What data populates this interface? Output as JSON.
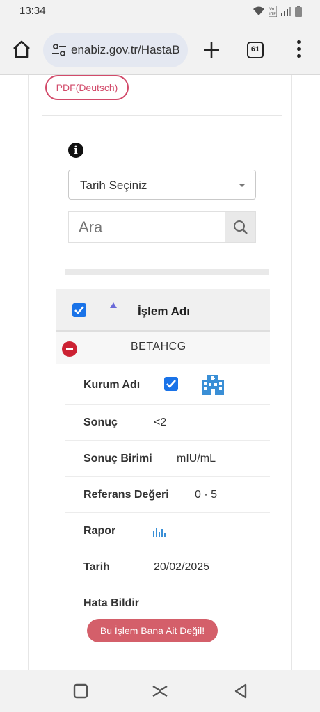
{
  "status_bar": {
    "time": "13:34",
    "icons": [
      "wifi-icon",
      "volte-icon",
      "signal-icon",
      "battery-icon"
    ]
  },
  "browser": {
    "url": "enabiz.gov.tr/HastaB",
    "tab_count": "61",
    "icons": [
      "home-icon",
      "site-settings-icon",
      "new-tab-icon",
      "tabs-icon",
      "more-menu-icon"
    ]
  },
  "page": {
    "pdf_button": "PDF(Deutsch)",
    "date_select": {
      "selected": "Tarih Seçiniz"
    },
    "search": {
      "placeholder": "Ara"
    },
    "table": {
      "header": {
        "column": "İşlem Adı",
        "checked": true
      },
      "group": {
        "name": "BETAHCG"
      },
      "rows": [
        {
          "label": "Kurum Adı",
          "value": "",
          "icons": [
            "checkbox-checked-icon",
            "hospital-icon"
          ]
        },
        {
          "label": "Sonuç",
          "value": "<2"
        },
        {
          "label": "Sonuç Birimi",
          "value": "mIU/mL"
        },
        {
          "label": "Referans Değeri",
          "value": "0 - 5"
        },
        {
          "label": "Rapor",
          "value": "",
          "icons": [
            "chart-icon"
          ]
        },
        {
          "label": "Tarih",
          "value": "20/02/2025"
        },
        {
          "label": "Hata Bildir",
          "value": ""
        }
      ],
      "report_button": "Bu İşlem Bana Ait Değil!"
    }
  },
  "colors": {
    "accent_pink": "#d24a6a",
    "checkbox_blue": "#1a73e8",
    "danger_red": "#cc2233",
    "report_button_bg": "#d45f6a",
    "icon_blue": "#3a8fd6"
  },
  "nav_bar": {
    "icons": [
      "recents-icon",
      "home-gesture-icon",
      "back-icon"
    ]
  }
}
